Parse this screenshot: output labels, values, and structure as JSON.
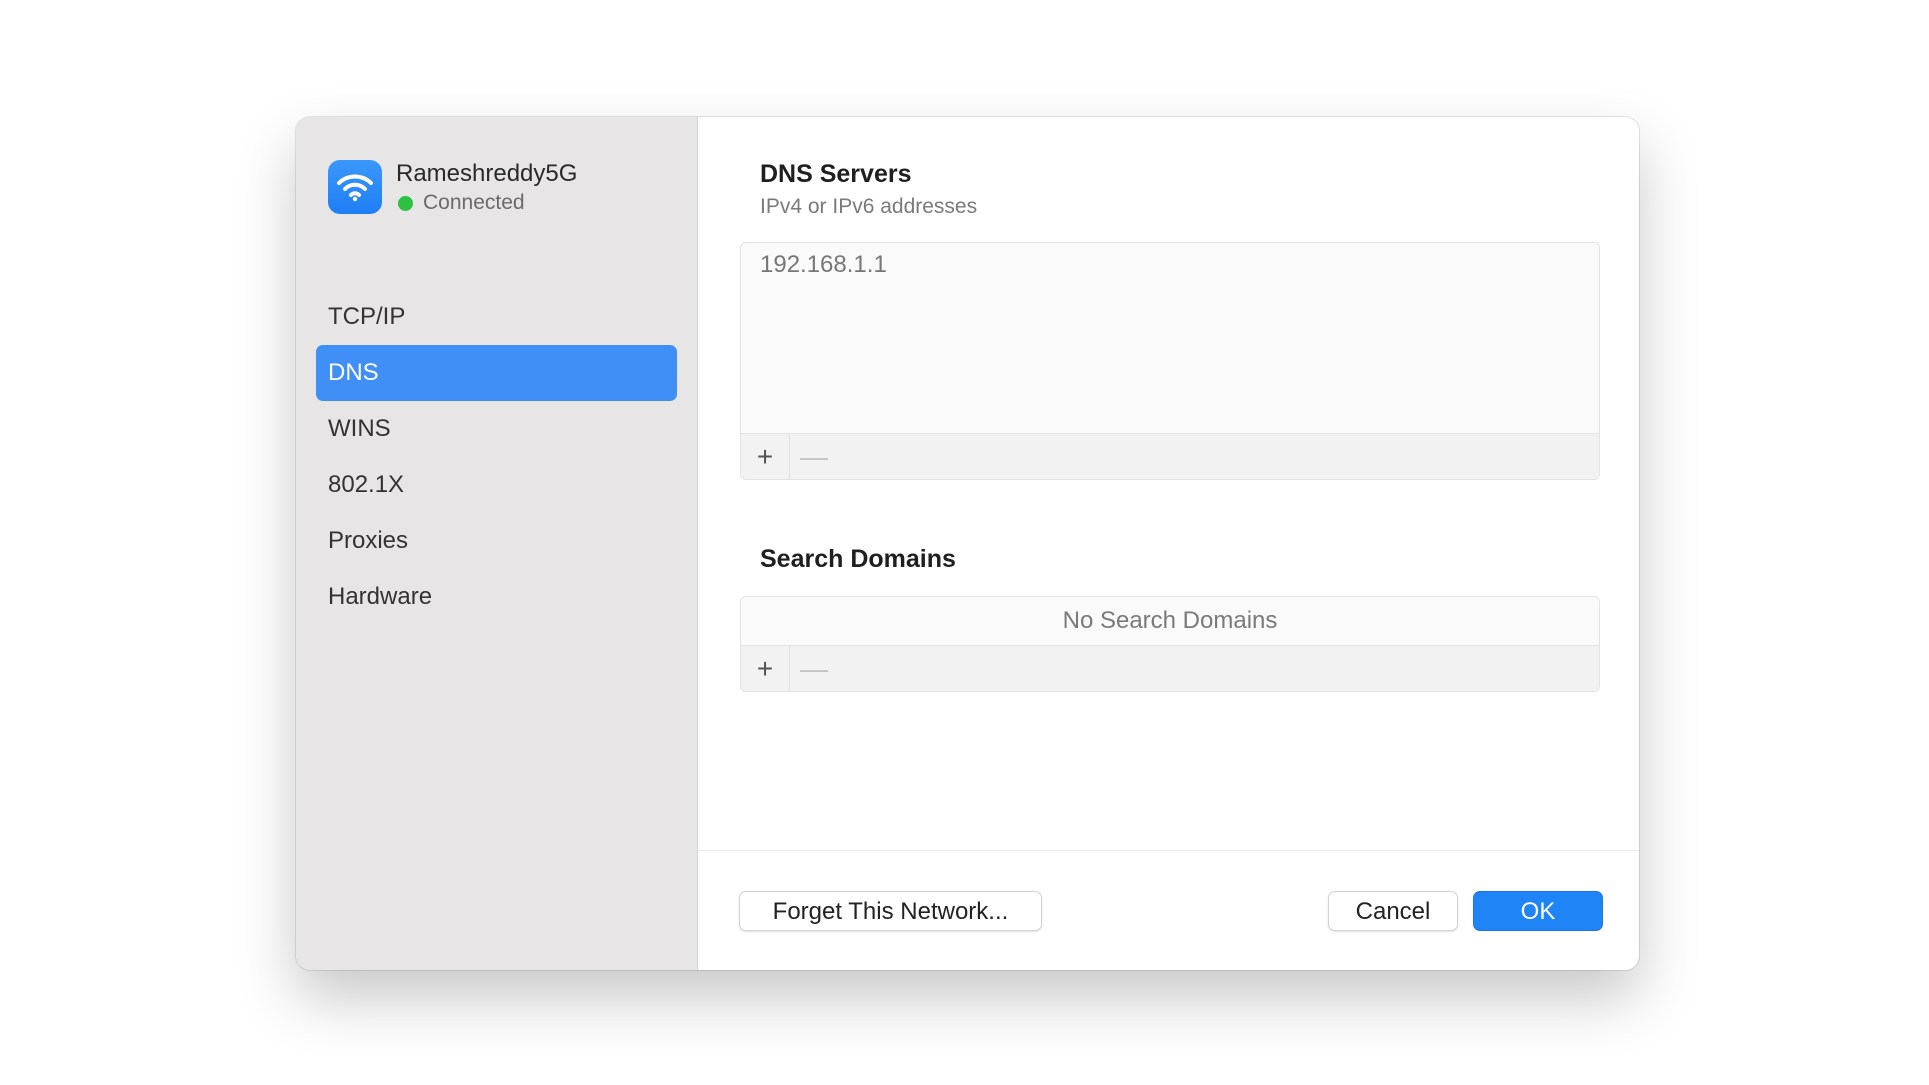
{
  "network": {
    "name": "Rameshreddy5G",
    "status": "Connected",
    "icon": "wifi-icon",
    "status_color": "#2cc142",
    "tile_color": "#2a8cf8"
  },
  "sidebar": {
    "items": [
      {
        "label": "TCP/IP",
        "selected": false
      },
      {
        "label": "DNS",
        "selected": true
      },
      {
        "label": "WINS",
        "selected": false
      },
      {
        "label": "802.1X",
        "selected": false
      },
      {
        "label": "Proxies",
        "selected": false
      },
      {
        "label": "Hardware",
        "selected": false
      }
    ],
    "selected_color": "#3f8ff6"
  },
  "dns_servers": {
    "title": "DNS Servers",
    "subtitle": "IPv4 or IPv6 addresses",
    "entries": [
      "192.168.1.1"
    ],
    "add_label": "+",
    "remove_label": "—"
  },
  "search_domains": {
    "title": "Search Domains",
    "empty_text": "No Search Domains",
    "add_label": "+",
    "remove_label": "—"
  },
  "footer": {
    "forget_label": "Forget This Network...",
    "cancel_label": "Cancel",
    "ok_label": "OK",
    "accent": "#1f84f5"
  }
}
